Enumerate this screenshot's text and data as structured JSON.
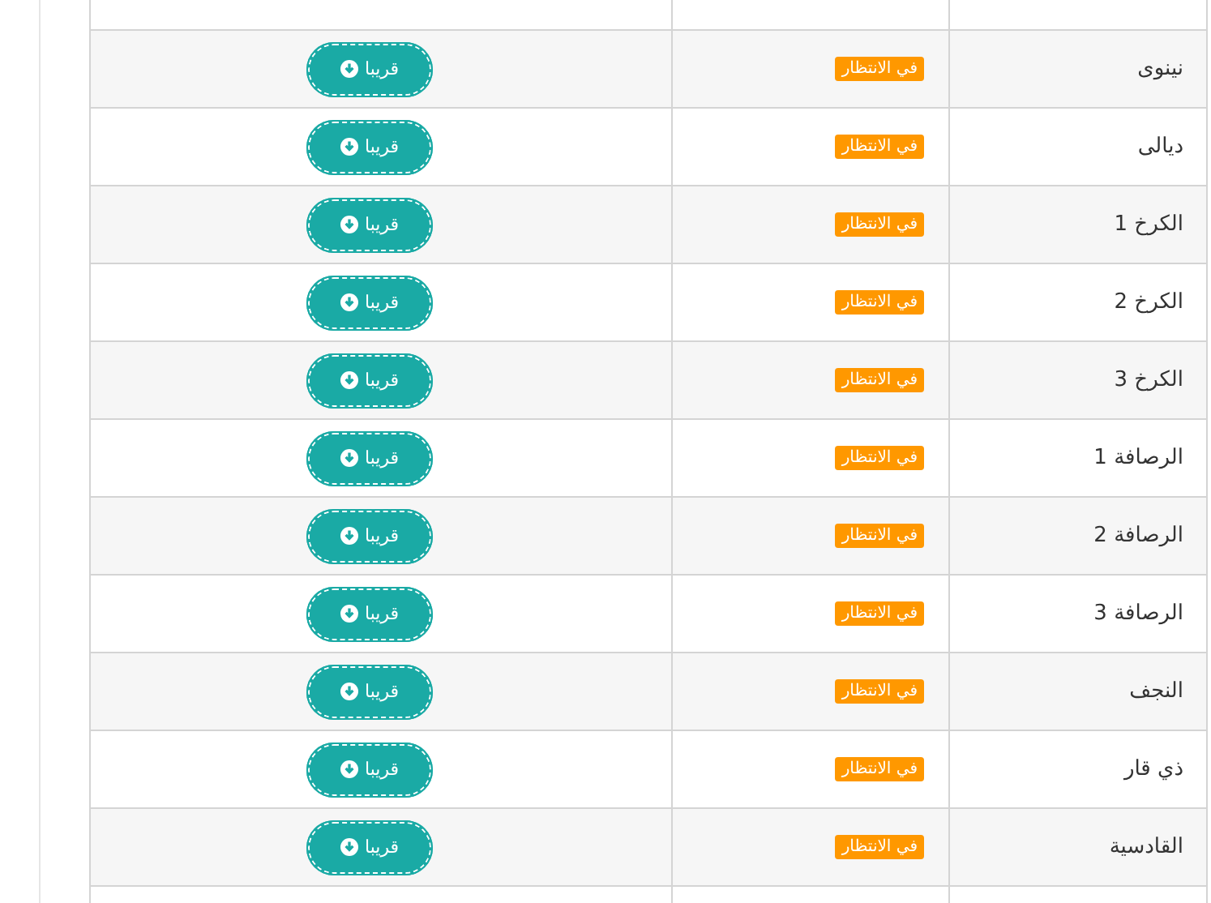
{
  "rows": [
    {
      "name": "نينوى",
      "status": "في الانتظار",
      "action": "قريبا"
    },
    {
      "name": "ديالى",
      "status": "في الانتظار",
      "action": "قريبا"
    },
    {
      "name": "الكرخ 1",
      "status": "في الانتظار",
      "action": "قريبا"
    },
    {
      "name": "الكرخ 2",
      "status": "في الانتظار",
      "action": "قريبا"
    },
    {
      "name": "الكرخ 3",
      "status": "في الانتظار",
      "action": "قريبا"
    },
    {
      "name": "الرصافة 1",
      "status": "في الانتظار",
      "action": "قريبا"
    },
    {
      "name": "الرصافة 2",
      "status": "في الانتظار",
      "action": "قريبا"
    },
    {
      "name": "الرصافة 3",
      "status": "في الانتظار",
      "action": "قريبا"
    },
    {
      "name": "النجف",
      "status": "في الانتظار",
      "action": "قريبا"
    },
    {
      "name": "ذي قار",
      "status": "في الانتظار",
      "action": "قريبا"
    },
    {
      "name": "القادسية",
      "status": "في الانتظار",
      "action": "قريبا"
    }
  ]
}
